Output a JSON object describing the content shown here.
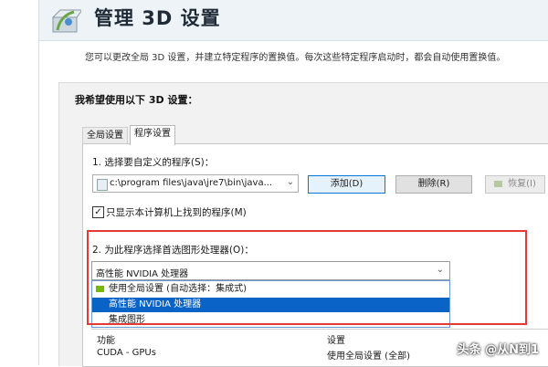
{
  "header": {
    "title": "管理 3D 设置",
    "subtitle": "您可以更改全局 3D 设置，并建立特定程序的置换值。每次这些特定程序启动时，都会自动使用置换值。"
  },
  "section": {
    "label": "我希望使用以下 3D 设置："
  },
  "tabs": [
    {
      "label": "全局设置"
    },
    {
      "label": "程序设置"
    }
  ],
  "program": {
    "step_label": "1. 选择要自定义的程序(S)：",
    "selected_value": "c:\\program files\\java\\jre7\\bin\\java...",
    "add_label": "添加(D)",
    "remove_label": "删除(R)",
    "restore_label": "恢复(I)",
    "checkbox_label": "只显示本计算机上找到的程序(M)",
    "checkbox_checked": true
  },
  "gpu": {
    "step_label": "2. 为此程序选择首选图形处理器(O)：",
    "selected_value": "高性能 NVIDIA 处理器",
    "options": [
      "使用全局设置 (自动选择：集成式)",
      "高性能 NVIDIA 处理器",
      "集成图形"
    ],
    "highlighted_index": 1
  },
  "table": {
    "headers": [
      "功能",
      "设置"
    ],
    "rows": [
      {
        "feature": "CUDA - GPUs",
        "setting": "使用全局设置 (全部)"
      }
    ]
  },
  "watermark": "头条 @从N到1",
  "colors": {
    "highlight": "#0a64c8",
    "red_annotation": "#e53935",
    "nvidia_green": "#76b900"
  }
}
